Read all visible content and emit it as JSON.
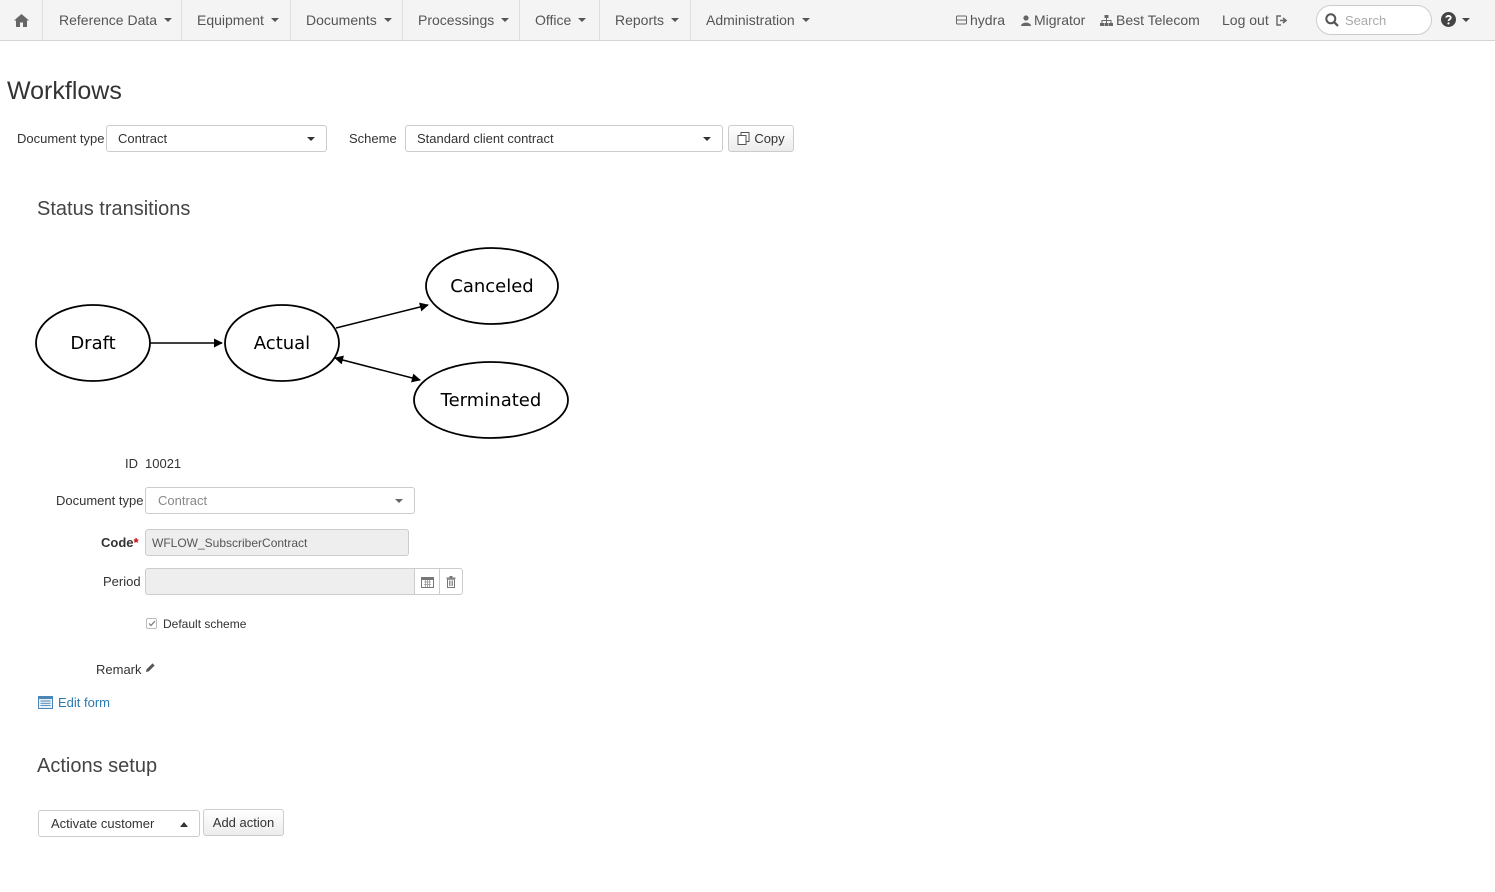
{
  "navbar": {
    "home_icon": "home-icon",
    "menus": [
      "Reference Data",
      "Equipment",
      "Documents",
      "Processings",
      "Office",
      "Reports",
      "Administration"
    ],
    "user_host": "hydra",
    "user_name": "Migrator",
    "company": "Best Telecom",
    "logout_label": "Log out",
    "search_placeholder": "Search",
    "help_icon": "question-circle-icon"
  },
  "page": {
    "title": "Workflows"
  },
  "filters": {
    "document_type_label": "Document type",
    "document_type_value": "Contract",
    "scheme_label": "Scheme",
    "scheme_value": "Standard client contract",
    "copy_label": "Copy"
  },
  "status_transitions": {
    "title": "Status transitions",
    "nodes": [
      "Draft",
      "Actual",
      "Canceled",
      "Terminated"
    ],
    "edges": [
      {
        "from": "Draft",
        "to": "Actual"
      },
      {
        "from": "Actual",
        "to": "Canceled"
      },
      {
        "from": "Actual",
        "to": "Terminated",
        "bidirectional": true
      }
    ]
  },
  "form": {
    "id_label": "ID",
    "id_value": "10021",
    "document_type_label": "Document type",
    "document_type_value": "Contract",
    "code_label": "Code",
    "code_required_mark": "*",
    "code_value": "WFLOW_SubscriberContract",
    "period_label": "Period",
    "period_value": "",
    "default_scheme_label": "Default scheme",
    "default_scheme_checked": true,
    "remark_label": "Remark",
    "edit_form_label": "Edit form"
  },
  "actions_setup": {
    "title": "Actions setup",
    "action_select_value": "Activate customer",
    "add_action_label": "Add action"
  }
}
